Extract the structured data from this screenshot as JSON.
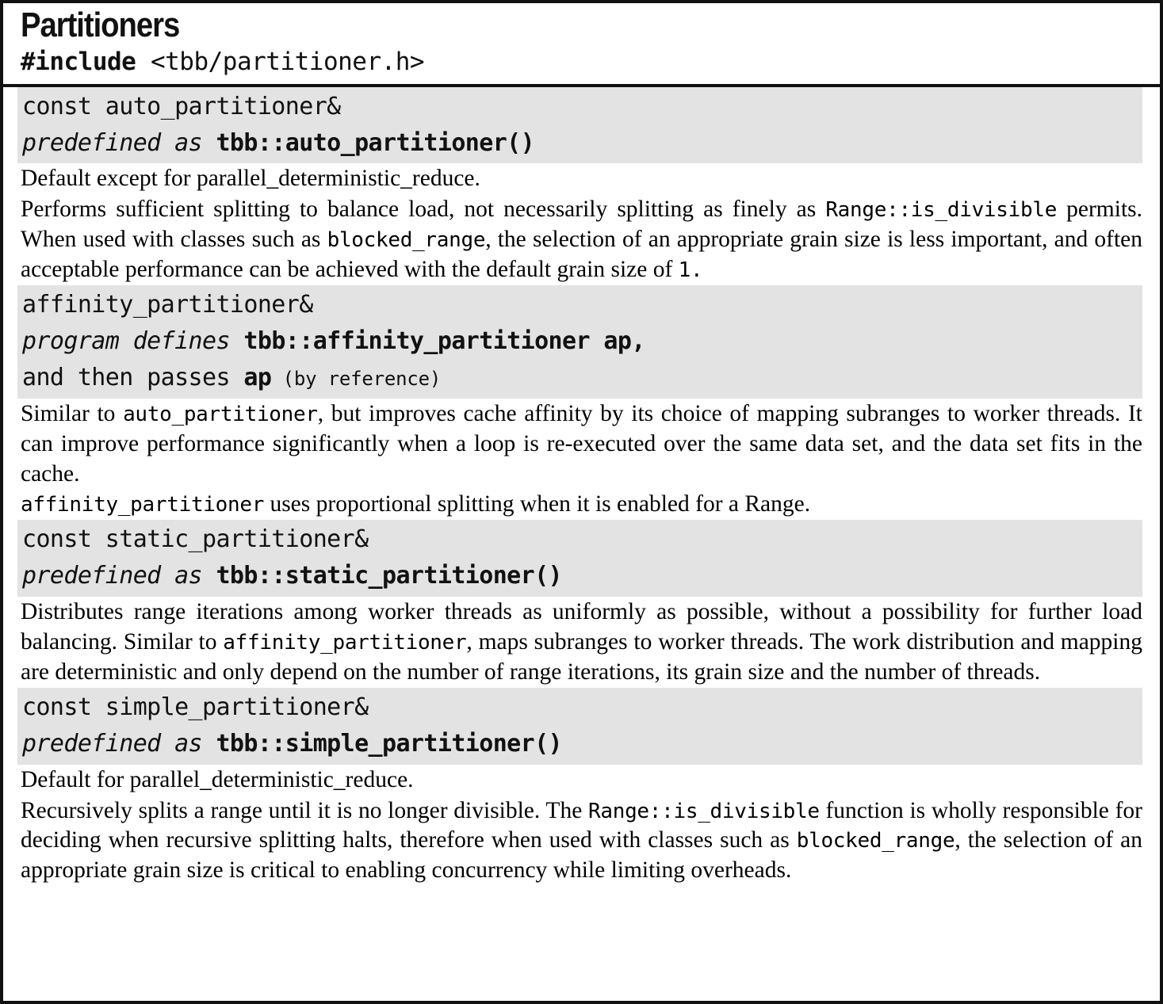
{
  "title": "Partitioners",
  "include": {
    "directive": "#include",
    "header": "<tbb/partitioner.h>"
  },
  "sections": [
    {
      "id": "auto-partitioner",
      "signature": [
        {
          "parts": [
            {
              "text": "const auto_partitioner&",
              "style": "plain"
            }
          ]
        },
        {
          "parts": [
            {
              "text": "predefined as ",
              "style": "italic"
            },
            {
              "text": "tbb::auto_partitioner()",
              "style": "bold"
            }
          ]
        }
      ],
      "paragraphs": [
        {
          "justify": false,
          "runs": [
            {
              "text": "Default except for parallel_deterministic_reduce.",
              "style": "serif"
            }
          ]
        },
        {
          "justify": true,
          "runs": [
            {
              "text": "Performs sufficient splitting to balance load, not necessarily splitting as finely as ",
              "style": "serif"
            },
            {
              "text": "Range::is_divisible",
              "style": "mono"
            },
            {
              "text": " permits. When used with classes such as ",
              "style": "serif"
            },
            {
              "text": "blocked_range",
              "style": "mono"
            },
            {
              "text": ", the selection of an appropriate grain size is less important, and often acceptable performance can be achieved with the default grain size of ",
              "style": "serif"
            },
            {
              "text": "1",
              "style": "mono"
            },
            {
              "text": ".",
              "style": "mono"
            }
          ]
        }
      ]
    },
    {
      "id": "affinity-partitioner",
      "signature": [
        {
          "parts": [
            {
              "text": "affinity_partitioner&",
              "style": "plain"
            }
          ]
        },
        {
          "parts": [
            {
              "text": "program defines ",
              "style": "italic"
            },
            {
              "text": "tbb::affinity_partitioner ap,",
              "style": "bold"
            }
          ]
        },
        {
          "parts": [
            {
              "text": "and then passes ",
              "style": "plain"
            },
            {
              "text": "ap",
              "style": "bold"
            },
            {
              "text": " (by reference)",
              "style": "small"
            }
          ]
        }
      ],
      "paragraphs": [
        {
          "justify": true,
          "runs": [
            {
              "text": "Similar to ",
              "style": "serif"
            },
            {
              "text": "auto_partitioner",
              "style": "mono"
            },
            {
              "text": ", but improves cache affinity by its choice of mapping subranges to worker threads. It can improve performance significantly when a loop is re-executed over the same data set, and the data set fits in the cache.",
              "style": "serif"
            }
          ]
        },
        {
          "justify": false,
          "runs": [
            {
              "text": "affinity_partitioner",
              "style": "mono"
            },
            {
              "text": " uses proportional splitting when it is enabled for a Range.",
              "style": "serif"
            }
          ]
        }
      ]
    },
    {
      "id": "static-partitioner",
      "signature": [
        {
          "parts": [
            {
              "text": "const static_partitioner&",
              "style": "plain"
            }
          ]
        },
        {
          "parts": [
            {
              "text": "predefined as ",
              "style": "italic"
            },
            {
              "text": "tbb::static_partitioner()",
              "style": "bold"
            }
          ]
        }
      ],
      "paragraphs": [
        {
          "justify": true,
          "runs": [
            {
              "text": "Distributes range iterations among worker threads as uniformly as possible, without a possibility for further load balancing. Similar to ",
              "style": "serif"
            },
            {
              "text": "affinity_partitioner",
              "style": "mono"
            },
            {
              "text": ", maps subranges to worker threads. The work distribution and mapping are deterministic and only depend on the number of range iterations, its grain size and the number of threads.",
              "style": "serif"
            }
          ]
        }
      ]
    },
    {
      "id": "simple-partitioner",
      "signature": [
        {
          "parts": [
            {
              "text": "const simple_partitioner&",
              "style": "plain"
            }
          ]
        },
        {
          "parts": [
            {
              "text": "predefined as ",
              "style": "italic"
            },
            {
              "text": "tbb::simple_partitioner()",
              "style": "bold"
            }
          ]
        }
      ],
      "paragraphs": [
        {
          "justify": false,
          "runs": [
            {
              "text": "Default for parallel_deterministic_reduce.",
              "style": "serif"
            }
          ]
        },
        {
          "justify": true,
          "runs": [
            {
              "text": "Recursively splits a range until it is no longer divisible. The ",
              "style": "serif"
            },
            {
              "text": "Range::is_divisible",
              "style": "mono"
            },
            {
              "text": " function is wholly responsible for deciding when recursive splitting halts, therefore when used with classes such as ",
              "style": "serif"
            },
            {
              "text": "blocked_range",
              "style": "mono"
            },
            {
              "text": ", the selection of an appropriate grain size is critical to enabling concurrency while limiting overheads.",
              "style": "serif"
            }
          ]
        }
      ]
    }
  ],
  "colors": {
    "band_gray": "#e3e3e3",
    "border": "#111111",
    "text": "#000000"
  }
}
